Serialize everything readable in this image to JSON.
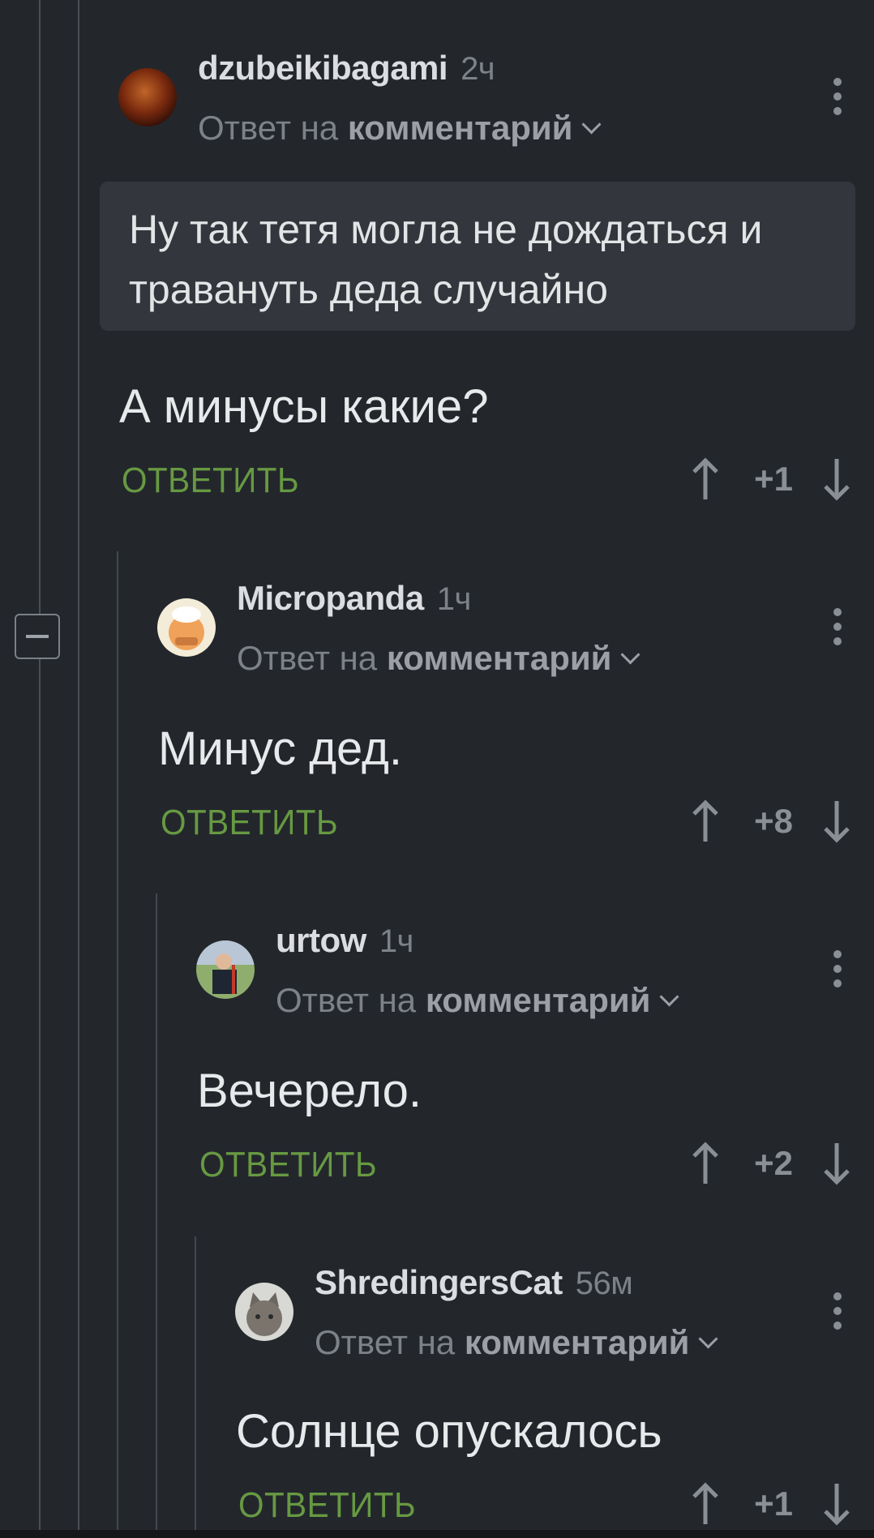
{
  "comments": [
    {
      "username": "dzubeikibagami",
      "time": "2ч",
      "reply_prefix": "Ответ на",
      "reply_target": "комментарий",
      "quote": "Ну так тетя могла не дождаться и травануть деда случайно",
      "text": "А минусы какие?",
      "reply_label": "ОТВЕТИТЬ",
      "score": "+1"
    },
    {
      "username": "Micropanda",
      "time": "1ч",
      "reply_prefix": "Ответ на",
      "reply_target": "комментарий",
      "text": "Минус дед.",
      "reply_label": "ОТВЕТИТЬ",
      "score": "+8"
    },
    {
      "username": "urtow",
      "time": "1ч",
      "reply_prefix": "Ответ на",
      "reply_target": "комментарий",
      "text": "Вечерело.",
      "reply_label": "ОТВЕТИТЬ",
      "score": "+2"
    },
    {
      "username": "ShredingersCat",
      "time": "56м",
      "reply_prefix": "Ответ на",
      "reply_target": "комментарий",
      "text": "Солнце опускалось",
      "reply_label": "ОТВЕТИТЬ",
      "score": "+1"
    }
  ],
  "colors": {
    "background": "#23272c",
    "accent_green": "#679942",
    "muted": "#7d8288"
  }
}
